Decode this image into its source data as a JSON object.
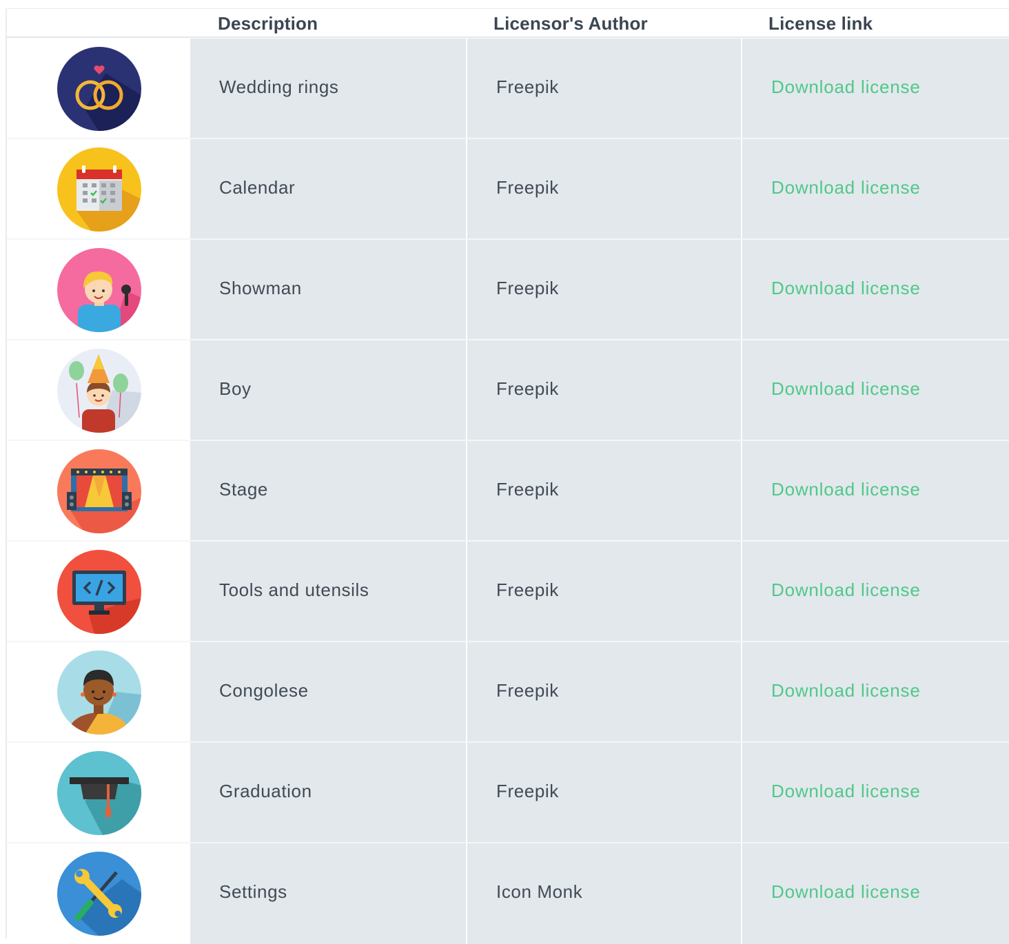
{
  "table": {
    "headers": {
      "description": "Description",
      "author": "Licensor's Author",
      "link": "License link"
    },
    "rows": [
      {
        "icon": "wedding-rings-icon",
        "description": "Wedding rings",
        "author": "Freepik",
        "link": "Download license"
      },
      {
        "icon": "calendar-icon",
        "description": "Calendar",
        "author": "Freepik",
        "link": "Download license"
      },
      {
        "icon": "showman-icon",
        "description": "Showman",
        "author": "Freepik",
        "link": "Download license"
      },
      {
        "icon": "boy-icon",
        "description": "Boy",
        "author": "Freepik",
        "link": "Download license"
      },
      {
        "icon": "stage-icon",
        "description": "Stage",
        "author": "Freepik",
        "link": "Download license"
      },
      {
        "icon": "code-monitor-icon",
        "description": "Tools and utensils",
        "author": "Freepik",
        "link": "Download license"
      },
      {
        "icon": "congolese-person-icon",
        "description": "Congolese",
        "author": "Freepik",
        "link": "Download license"
      },
      {
        "icon": "graduation-cap-icon",
        "description": "Graduation",
        "author": "Freepik",
        "link": "Download license"
      },
      {
        "icon": "settings-tools-icon",
        "description": "Settings",
        "author": "Icon Monk",
        "link": "Download license"
      }
    ]
  },
  "colors": {
    "link": "#4fc88a",
    "cell_bg": "#e3e8ec",
    "text": "#414b55"
  }
}
